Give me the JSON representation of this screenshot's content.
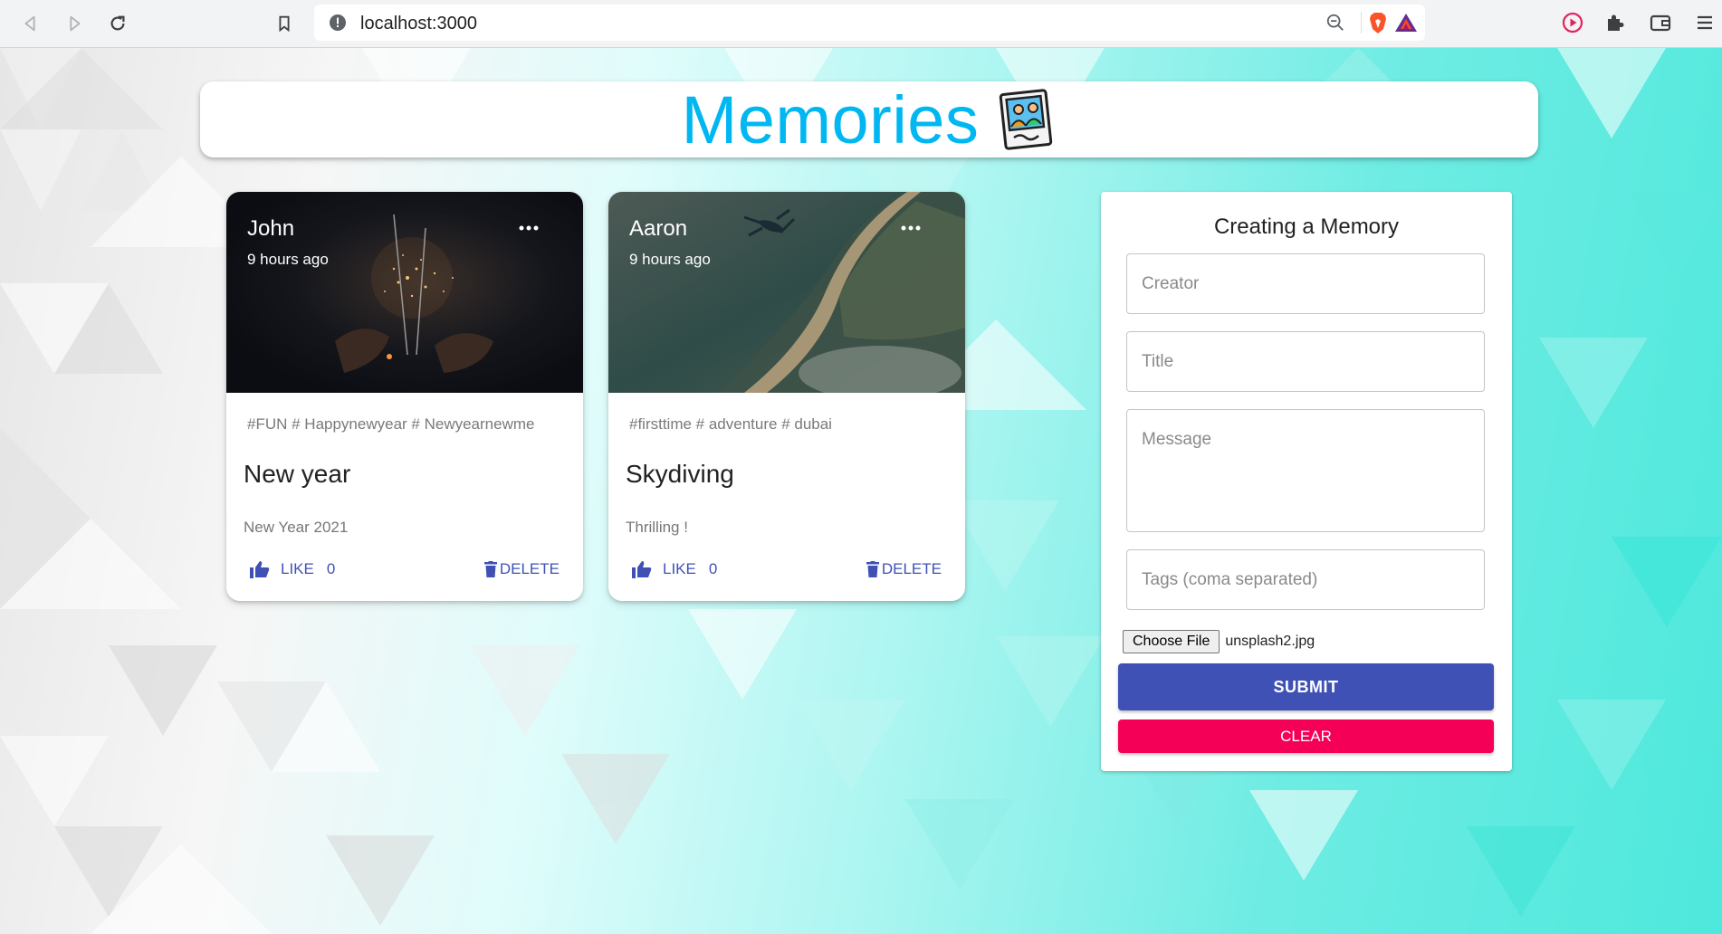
{
  "browser": {
    "url": "localhost:3000"
  },
  "header": {
    "title": "Memories",
    "title_color": "#00b7f1"
  },
  "posts": [
    {
      "creator": "John",
      "time": "9 hours ago",
      "tags": "#FUN # Happynewyear # Newyearnewme",
      "title": "New year",
      "message": "New Year 2021",
      "like_label": "LIKE",
      "like_count": "0",
      "delete_label": "DELETE",
      "image": "sparklers-night-photo"
    },
    {
      "creator": "Aaron",
      "time": "9 hours ago",
      "tags": "#firsttime # adventure # dubai",
      "title": "Skydiving",
      "message": "Thrilling !",
      "like_label": "LIKE",
      "like_count": "0",
      "delete_label": "DELETE",
      "image": "skydiver-over-coast-photo"
    }
  ],
  "form": {
    "title": "Creating a Memory",
    "creator_placeholder": "Creator",
    "title_placeholder": "Title",
    "message_placeholder": "Message",
    "tags_placeholder": "Tags (coma separated)",
    "file_button": "Choose File",
    "file_name": "unsplash2.jpg",
    "submit_label": "SUBMIT",
    "clear_label": "CLEAR"
  },
  "colors": {
    "primary": "#3f51b5",
    "secondary": "#f50057"
  }
}
